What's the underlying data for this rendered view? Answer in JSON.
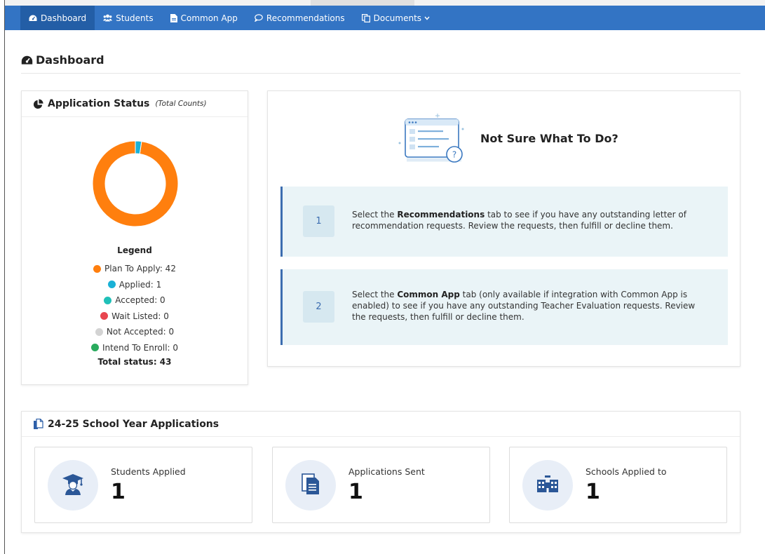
{
  "nav": {
    "items": [
      {
        "label": "Dashboard",
        "icon": "tachometer-icon",
        "active": true
      },
      {
        "label": "Students",
        "icon": "users-icon"
      },
      {
        "label": "Common App",
        "icon": "file-icon"
      },
      {
        "label": "Recommendations",
        "icon": "comment-icon"
      },
      {
        "label": "Documents",
        "icon": "copy-icon",
        "dropdown": true
      }
    ],
    "color": "#3374c4"
  },
  "page": {
    "title": "Dashboard"
  },
  "status": {
    "title": "Application Status",
    "subtitle": "(Total Counts)",
    "legend_title": "Legend",
    "legend": [
      {
        "label": "Plan To Apply: 42",
        "color": "#ff7f0e"
      },
      {
        "label": "Applied: 1",
        "color": "#1ab1d6"
      },
      {
        "label": "Accepted: 0",
        "color": "#20c0b8"
      },
      {
        "label": "Wait Listed: 0",
        "color": "#e8464f"
      },
      {
        "label": "Not Accepted: 0",
        "color": "#d3d3d3"
      },
      {
        "label": "Intend To Enroll: 0",
        "color": "#2aab5e"
      }
    ],
    "total": "Total status: 43"
  },
  "chart_data": {
    "type": "pie",
    "categories": [
      "Plan To Apply",
      "Applied",
      "Accepted",
      "Wait Listed",
      "Not Accepted",
      "Intend To Enroll"
    ],
    "values": [
      42,
      1,
      0,
      0,
      0,
      0
    ],
    "colors": [
      "#ff7f0e",
      "#1ab1d6",
      "#20c0b8",
      "#e8464f",
      "#d3d3d3",
      "#2aab5e"
    ],
    "donut": true
  },
  "help": {
    "heading": "Not Sure What To Do?",
    "steps": [
      {
        "num": "1",
        "pre": "Select the ",
        "bold": "Recommendations",
        "post": " tab to see if you have any outstanding letter of recommendation requests. Review the requests, then fulfill or decline them."
      },
      {
        "num": "2",
        "pre": "Select the ",
        "bold": "Common App",
        "post": " tab (only available if integration with Common App is enabled) to see if you have any outstanding Teacher Evaluation requests. Review the requests, then fulfill or decline them."
      }
    ]
  },
  "apps": {
    "title": "24-25 School Year Applications",
    "stats": [
      {
        "label": "Students Applied",
        "value": "1",
        "icon": "graduate-icon"
      },
      {
        "label": "Applications Sent",
        "value": "1",
        "icon": "documents-icon"
      },
      {
        "label": "Schools Applied to",
        "value": "1",
        "icon": "school-icon"
      }
    ]
  }
}
